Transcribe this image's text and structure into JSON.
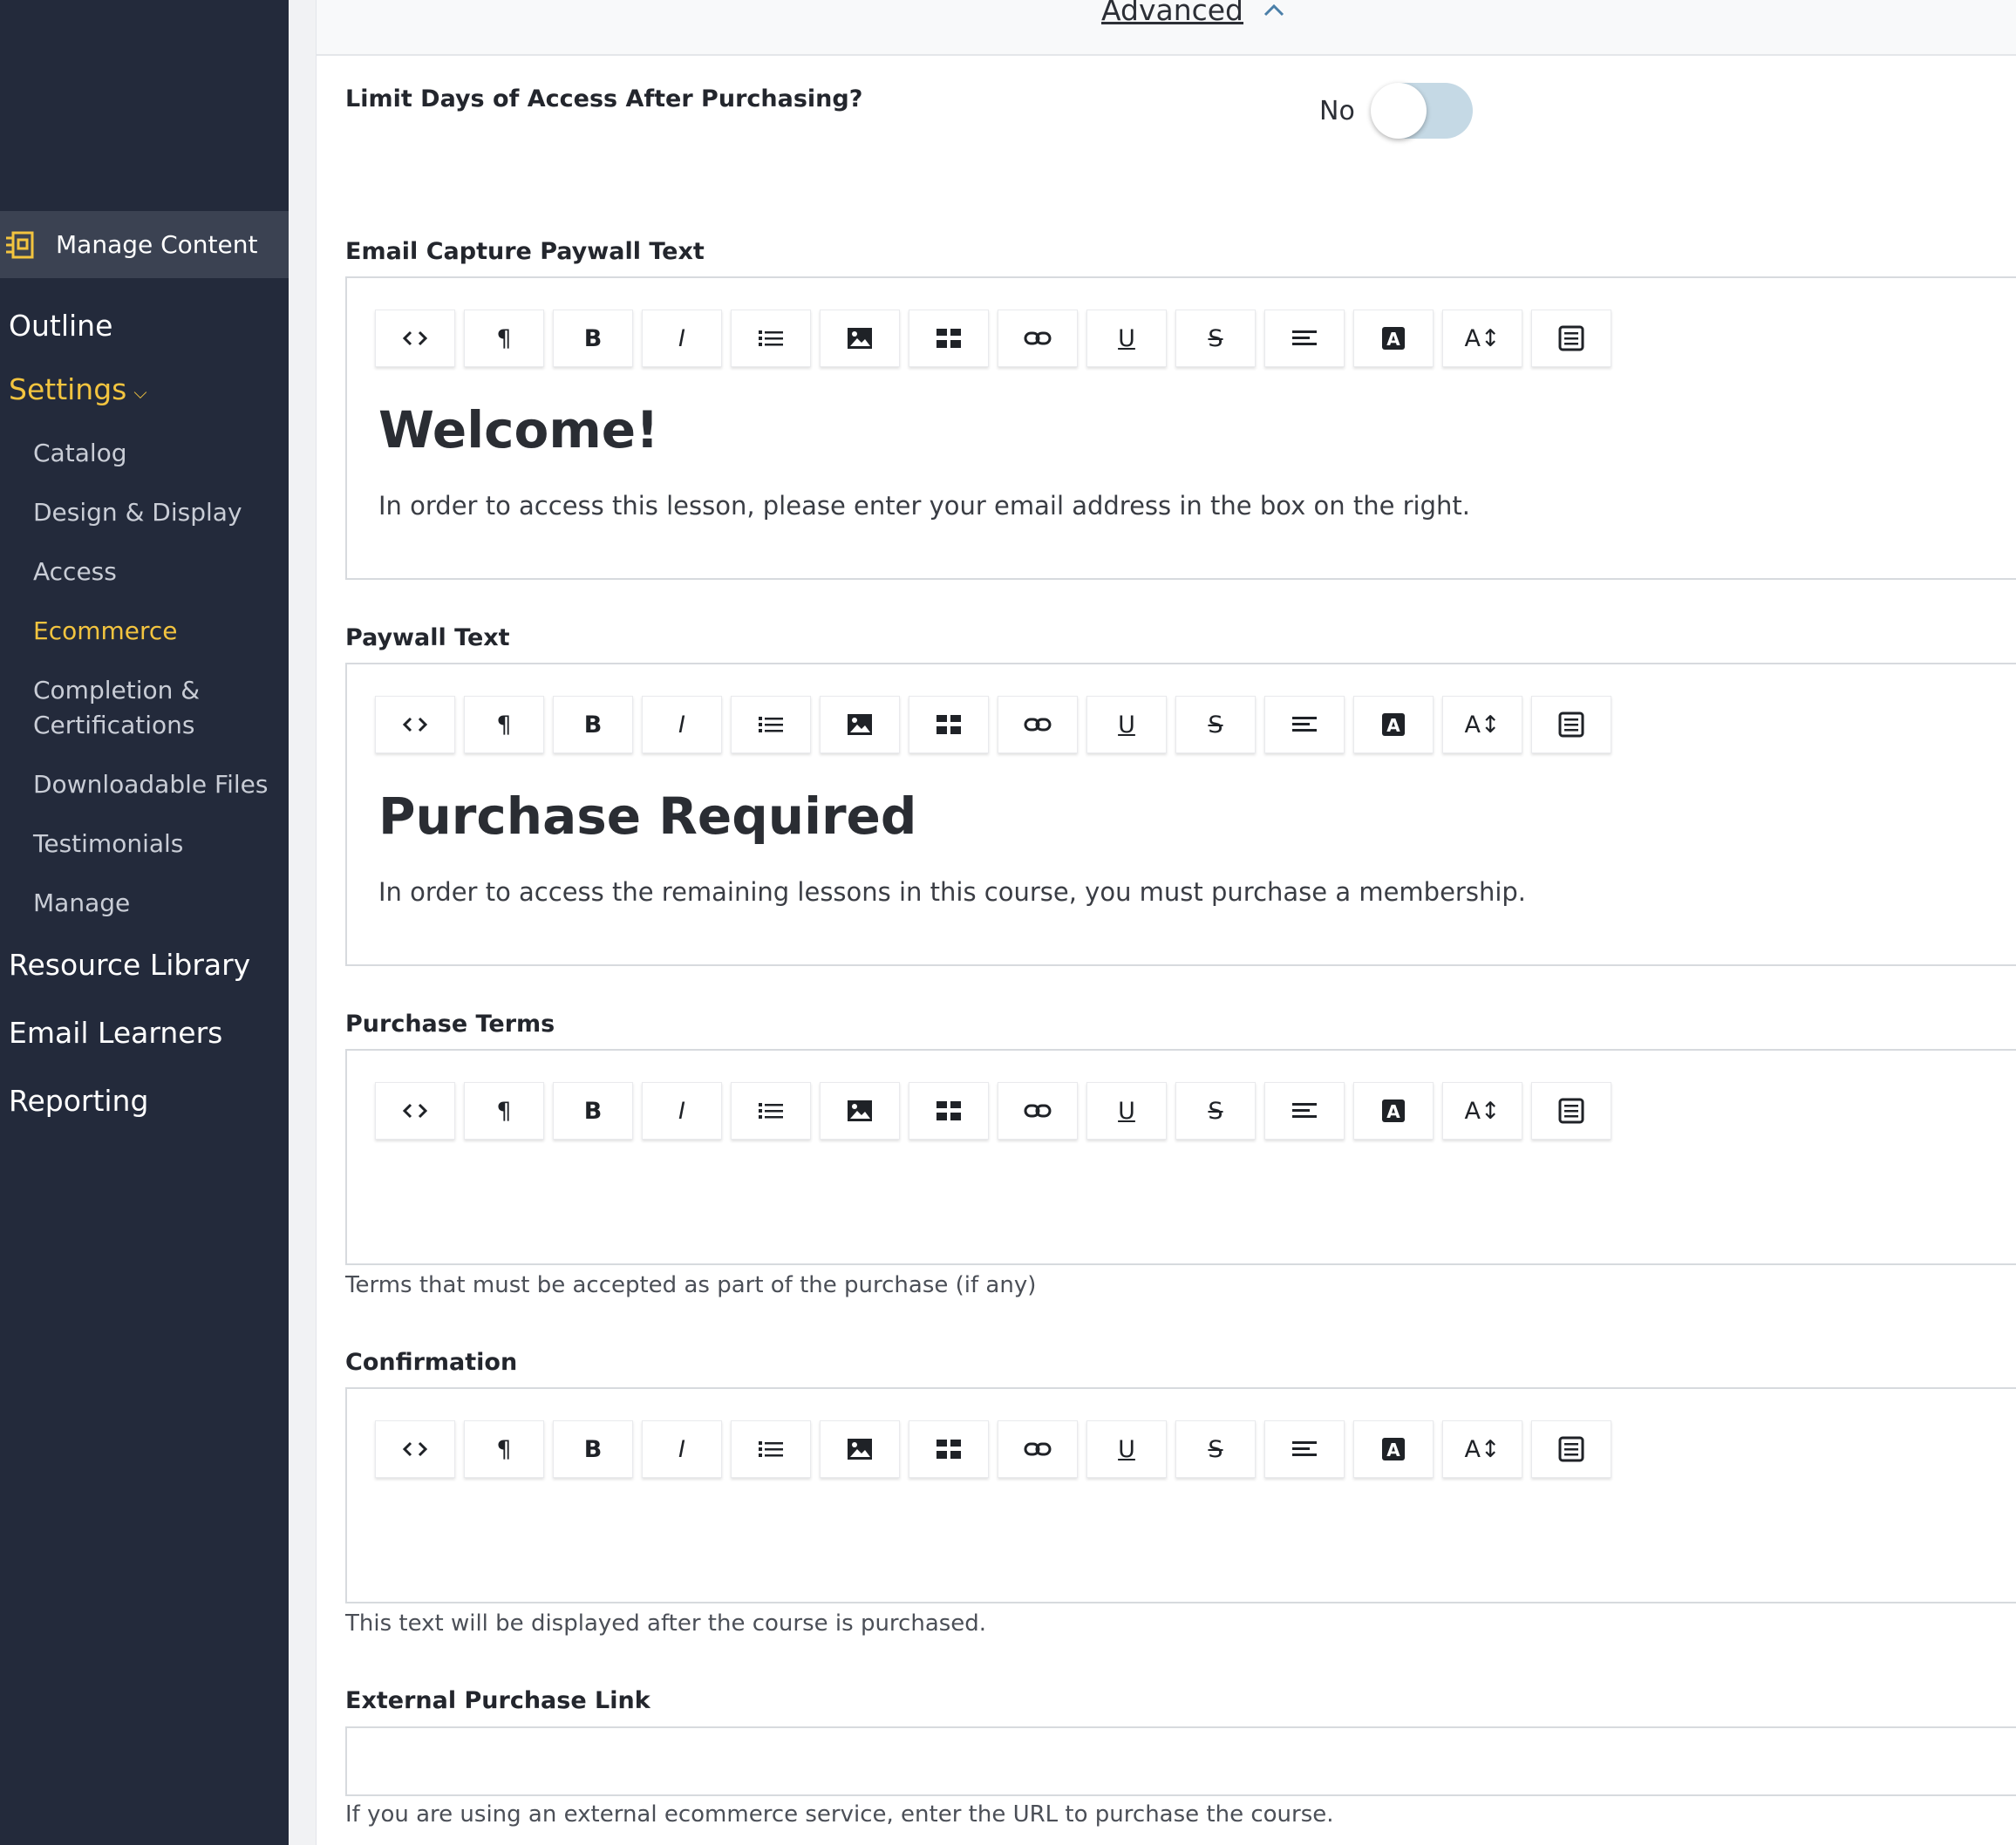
{
  "sidebar": {
    "manage_content": "Manage Content",
    "outline": "Outline",
    "settings": "Settings",
    "settings_items": [
      {
        "label": "Catalog"
      },
      {
        "label": "Design & Display"
      },
      {
        "label": "Access"
      },
      {
        "label": "Ecommerce"
      },
      {
        "label": "Completion &"
      },
      {
        "label": "Certifications"
      },
      {
        "label": "Downloadable Files"
      },
      {
        "label": "Testimonials"
      },
      {
        "label": "Manage"
      }
    ],
    "resource_library": "Resource Library",
    "email_learners": "Email Learners",
    "reporting": "Reporting",
    "active_color": "#f3c43f"
  },
  "main": {
    "advanced": "Advanced",
    "limit_days": {
      "label": "Limit Days of Access After Purchasing?",
      "value": "No"
    },
    "email_capture": {
      "label": "Email Capture Paywall Text",
      "heading": "Welcome!",
      "body": "In order to access this lesson, please enter your email address in the box on the right."
    },
    "paywall": {
      "label": "Paywall Text",
      "heading": "Purchase Required",
      "body": "In order to access the remaining lessons in this course, you must purchase a membership."
    },
    "purchase_terms": {
      "label": "Purchase Terms",
      "help": "Terms that must be accepted as part of the purchase (if any)"
    },
    "confirmation": {
      "label": "Confirmation",
      "help": "This text will be displayed after the course is purchased."
    },
    "external_link": {
      "label": "External Purchase Link",
      "help": "If you are using an external ecommerce service, enter the URL to purchase the course."
    }
  },
  "toolbar": {
    "buttons": [
      "code-icon",
      "paragraph-icon",
      "bold-icon",
      "italic-icon",
      "list-icon",
      "image-icon",
      "table-icon",
      "link-icon",
      "underline-icon",
      "strikethrough-icon",
      "align-icon",
      "font-color-icon",
      "font-size-icon",
      "formatting-icon"
    ],
    "paragraph": "¶",
    "bold": "B",
    "italic": "I",
    "underline": "U",
    "strike": "S",
    "fontsize": "A↕"
  }
}
